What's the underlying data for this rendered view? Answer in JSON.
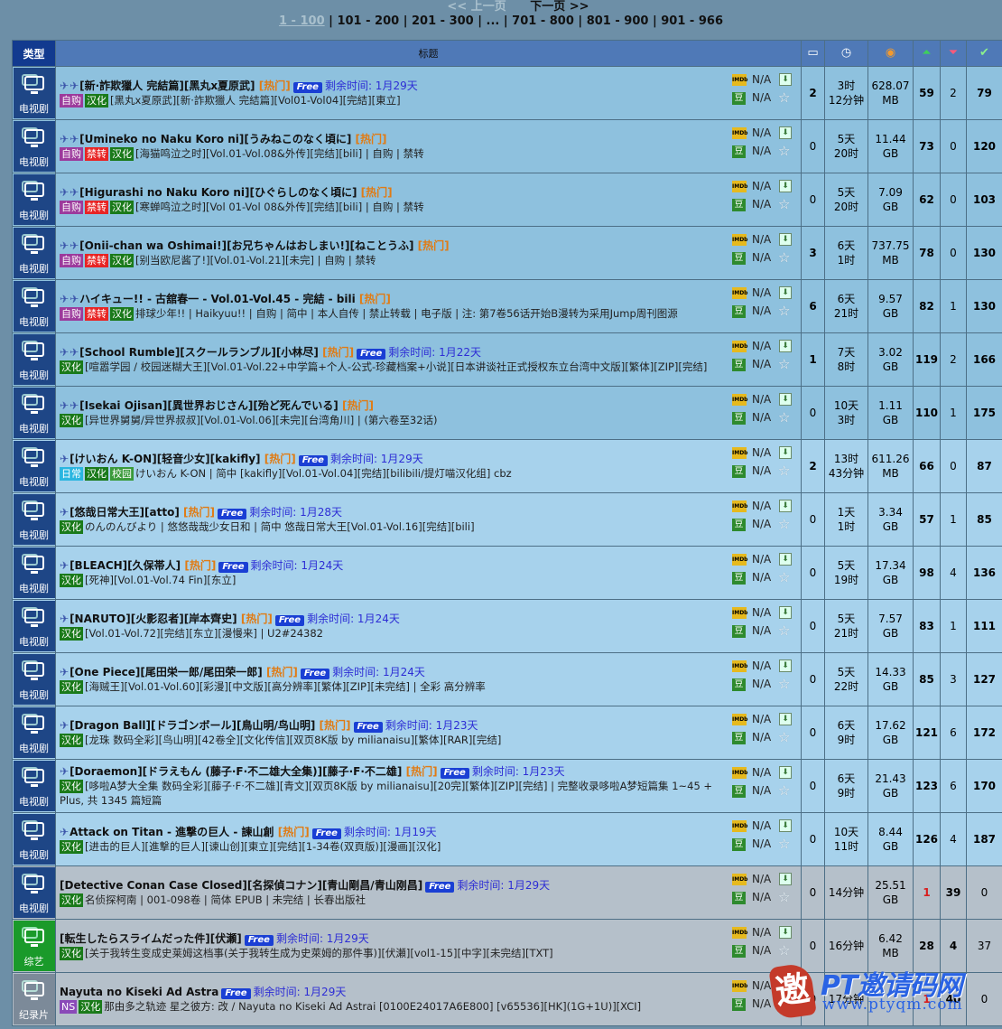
{
  "pager": {
    "prev": "<< 上一页",
    "next": "下一页 >>",
    "current": "1 - 100",
    "pages": [
      "101 - 200",
      "201 - 300",
      "...",
      "701 - 800",
      "801 - 900",
      "901 - 966"
    ]
  },
  "header": {
    "category": "类型",
    "title": "标题",
    "icons": [
      "comments-icon",
      "time-icon",
      "size-icon",
      "seeders-icon",
      "leechers-icon",
      "completed-icon"
    ]
  },
  "rows": [
    {
      "cat": "电视剧",
      "pins": 2,
      "title": "[新·詐欺獵人 完結篇][黑丸x夏原武]",
      "hot": "[热门]",
      "free": true,
      "remain": "剩余时间: 1月29天",
      "tags": [
        "自购",
        "汉化"
      ],
      "sub": "[黑丸x夏原武][新·詐欺獵人 完結篇][Vol01-Vol04][完結][東立]",
      "comments": "2",
      "time1": "3时",
      "time2": "12分钟",
      "size1": "628.07",
      "size2": "MB",
      "se": "59",
      "le": "2",
      "co": "79",
      "style": "c1"
    },
    {
      "cat": "电视剧",
      "pins": 2,
      "title": "[Umineko no Naku Koro ni][うみねこのなく頃に]",
      "hot": "[热门]",
      "free": false,
      "remain": "",
      "tags": [
        "自购",
        "禁转",
        "汉化"
      ],
      "sub": "[海猫鸣泣之时][Vol.01-Vol.08&外传][完结][bili] | 自购 | 禁转",
      "comments": "0",
      "time1": "5天",
      "time2": "20时",
      "size1": "11.44",
      "size2": "GB",
      "se": "73",
      "le": "0",
      "co": "120",
      "style": "c1"
    },
    {
      "cat": "电视剧",
      "pins": 2,
      "title": "[Higurashi no Naku Koro ni][ひぐらしのなく頃に]",
      "hot": "[热门]",
      "free": false,
      "remain": "",
      "tags": [
        "自购",
        "禁转",
        "汉化"
      ],
      "sub": "[寒蝉鸣泣之时][Vol 01-Vol 08&外传][完结][bili] | 自购 | 禁转",
      "comments": "0",
      "time1": "5天",
      "time2": "20时",
      "size1": "7.09",
      "size2": "GB",
      "se": "62",
      "le": "0",
      "co": "103",
      "style": "c1"
    },
    {
      "cat": "电视剧",
      "pins": 2,
      "title": "[Onii-chan wa Oshimai!][お兄ちゃんはおしまい!][ねことうふ]",
      "hot": "[热门]",
      "free": false,
      "remain": "",
      "tags": [
        "自购",
        "禁转",
        "汉化"
      ],
      "sub": "[别当欧尼酱了!][Vol.01-Vol.21][未完] | 自购 | 禁转",
      "comments": "3",
      "time1": "6天",
      "time2": "1时",
      "size1": "737.75",
      "size2": "MB",
      "se": "78",
      "le": "0",
      "co": "130",
      "style": "c1"
    },
    {
      "cat": "电视剧",
      "pins": 2,
      "title": "ハイキュー!! - 古舘春一 - Vol.01-Vol.45 - 完結 - bili",
      "hot": "[热门]",
      "free": false,
      "remain": "",
      "tags": [
        "自购",
        "禁转",
        "汉化"
      ],
      "sub": "排球少年!! | Haikyuu!! | 自购 | 简中 | 本人自传 | 禁止转载 | 电子版 | 注: 第7卷56话开始B漫转为采用Jump周刊图源",
      "comments": "6",
      "time1": "6天",
      "time2": "21时",
      "size1": "9.57",
      "size2": "GB",
      "se": "82",
      "le": "1",
      "co": "130",
      "style": "c1"
    },
    {
      "cat": "电视剧",
      "pins": 2,
      "title": "[School Rumble][スクールランブル][小林尽]",
      "hot": "[热门]",
      "free": true,
      "remain": "剩余时间: 1月22天",
      "tags": [
        "汉化"
      ],
      "sub": "[喧嚣学园 / 校园迷糊大王][Vol.01-Vol.22+中学篇+个人-公式-珍藏档案+小说][日本讲谈社正式授权东立台湾中文版][繁体][ZIP][完结]",
      "comments": "1",
      "time1": "7天",
      "time2": "8时",
      "size1": "3.02",
      "size2": "GB",
      "se": "119",
      "le": "2",
      "co": "166",
      "style": "c1"
    },
    {
      "cat": "电视剧",
      "pins": 2,
      "title": "[Isekai Ojisan][異世界おじさん][殆ど死んでいる]",
      "hot": "[热门]",
      "free": false,
      "remain": "",
      "tags": [
        "汉化"
      ],
      "sub": "[异世界舅舅/异世界叔叔][Vol.01-Vol.06][未完][台湾角川] | (第六卷至32话)",
      "comments": "0",
      "time1": "10天",
      "time2": "3时",
      "size1": "1.11",
      "size2": "GB",
      "se": "110",
      "le": "1",
      "co": "175",
      "style": "c1"
    },
    {
      "cat": "电视剧",
      "pins": 1,
      "title": "[けいおん K-ON][轻音少女][kakifly]",
      "hot": "[热门]",
      "free": true,
      "remain": "剩余时间: 1月29天",
      "tags": [
        "日常",
        "汉化",
        "校园"
      ],
      "sub": "けいおん K-ON | 简中 [kakifly][Vol.01-Vol.04][完结][bilibili/提灯喵汉化组] cbz",
      "comments": "2",
      "time1": "13时",
      "time2": "43分钟",
      "size1": "611.26",
      "size2": "MB",
      "se": "66",
      "le": "0",
      "co": "87",
      "style": "c2"
    },
    {
      "cat": "电视剧",
      "pins": 1,
      "title": "[悠哉日常大王][atto]",
      "hot": "[热门]",
      "free": true,
      "remain": "剩余时间: 1月28天",
      "tags": [
        "汉化"
      ],
      "sub": "のんのんびより | 悠悠哉哉少女日和 | 简中 悠哉日常大王[Vol.01-Vol.16][完结][bili]",
      "comments": "0",
      "time1": "1天",
      "time2": "1时",
      "size1": "3.34",
      "size2": "GB",
      "se": "57",
      "le": "1",
      "co": "85",
      "style": "c2"
    },
    {
      "cat": "电视剧",
      "pins": 1,
      "title": "[BLEACH][久保帯人]",
      "hot": "[热门]",
      "free": true,
      "remain": "剩余时间: 1月24天",
      "tags": [
        "汉化"
      ],
      "sub": "[死神][Vol.01-Vol.74 Fin][东立]",
      "comments": "0",
      "time1": "5天",
      "time2": "19时",
      "size1": "17.34",
      "size2": "GB",
      "se": "98",
      "le": "4",
      "co": "136",
      "style": "c2"
    },
    {
      "cat": "电视剧",
      "pins": 1,
      "title": "[NARUTO][火影忍者][岸本齊史]",
      "hot": "[热门]",
      "free": true,
      "remain": "剩余时间: 1月24天",
      "tags": [
        "汉化"
      ],
      "sub": "[Vol.01-Vol.72][完结][东立][漫慢来] | U2#24382",
      "comments": "0",
      "time1": "5天",
      "time2": "21时",
      "size1": "7.57",
      "size2": "GB",
      "se": "83",
      "le": "1",
      "co": "111",
      "style": "c2"
    },
    {
      "cat": "电视剧",
      "pins": 1,
      "title": "[One Piece][尾田栄一郎/尾田荣一郎]",
      "hot": "[热门]",
      "free": true,
      "remain": "剩余时间: 1月24天",
      "tags": [
        "汉化"
      ],
      "sub": "[海贼王][Vol.01-Vol.60][彩漫][中文版][高分辨率][繁体][ZIP][未完结] | 全彩 高分辨率",
      "comments": "0",
      "time1": "5天",
      "time2": "22时",
      "size1": "14.33",
      "size2": "GB",
      "se": "85",
      "le": "3",
      "co": "127",
      "style": "c2"
    },
    {
      "cat": "电视剧",
      "pins": 1,
      "title": "[Dragon Ball][ドラゴンボール][鳥山明/鸟山明]",
      "hot": "[热门]",
      "free": true,
      "remain": "剩余时间: 1月23天",
      "tags": [
        "汉化"
      ],
      "sub": "[龙珠 数码全彩][鸟山明][42卷全][文化传信][双页8K版 by milianaisu][繁体][RAR][完结]",
      "comments": "0",
      "time1": "6天",
      "time2": "9时",
      "size1": "17.62",
      "size2": "GB",
      "se": "121",
      "le": "6",
      "co": "172",
      "style": "c2"
    },
    {
      "cat": "电视剧",
      "pins": 1,
      "title": "[Doraemon][ドラえもん (藤子·F·不二雄大全集)][藤子·F·不二雄]",
      "hot": "[热门]",
      "free": true,
      "remain": "剩余时间: 1月23天",
      "tags": [
        "汉化"
      ],
      "sub": "[哆啦A梦大全集 数码全彩][藤子·F·不二雄][青文][双页8K版 by milianaisu][20完][繁体][ZIP][完结] | 完整收录哆啦A梦短篇集 1~45 + Plus, 共 1345 篇短篇",
      "comments": "0",
      "time1": "6天",
      "time2": "9时",
      "size1": "21.43",
      "size2": "GB",
      "se": "123",
      "le": "6",
      "co": "170",
      "style": "c2"
    },
    {
      "cat": "电视剧",
      "pins": 1,
      "title": "Attack on Titan - 進撃の巨人 - 諫山創",
      "hot": "[热门]",
      "free": true,
      "remain": "剩余时间: 1月19天",
      "tags": [
        "汉化"
      ],
      "sub": "[进击的巨人][進撃的巨人][谏山创][東立][完结][1-34卷(双頁版)][漫画][汉化]",
      "comments": "0",
      "time1": "10天",
      "time2": "11时",
      "size1": "8.44",
      "size2": "GB",
      "se": "126",
      "le": "4",
      "co": "187",
      "style": "c2"
    },
    {
      "cat": "电视剧",
      "pins": 0,
      "title": "[Detective Conan Case Closed][名探偵コナン][青山剛昌/青山刚昌]",
      "hot": "",
      "free": true,
      "remain": "剩余时间: 1月29天",
      "tags": [
        "汉化"
      ],
      "sub": "名侦探柯南 | 001-098卷 | 简体 EPUB | 未完结 | 长春出版社",
      "comments": "0",
      "time1": "14分钟",
      "time2": "",
      "size1": "25.51",
      "size2": "GB",
      "se": "1",
      "le": "39",
      "co": "0",
      "style": "c3",
      "cat_style": "blue"
    },
    {
      "cat": "综艺",
      "pins": 0,
      "title": "[転生したらスライムだった件][伏瀬]",
      "hot": "",
      "free": true,
      "remain": "剩余时间: 1月29天",
      "tags": [
        "汉化"
      ],
      "sub": "[关于我转生变成史莱姆这档事(关于我转生成为史萊姆的那件事)][伏瀬][vol1-15][中字][未完结][TXT]",
      "comments": "0",
      "time1": "16分钟",
      "time2": "",
      "size1": "6.42",
      "size2": "MB",
      "se": "28",
      "le": "4",
      "co": "37",
      "style": "c3",
      "cat_style": "green"
    },
    {
      "cat": "纪录片",
      "pins": 0,
      "title": "Nayuta no Kiseki Ad Astra",
      "hot": "",
      "free": true,
      "remain": "剩余时间: 1月29天",
      "tags": [
        "NS",
        "汉化"
      ],
      "sub": "那由多之轨迹 星之彼方: 改 / Nayuta no Kiseki Ad Astrai [0100E24017A6E800] [v65536][HK](1G+1U)][XCI]",
      "comments": "0",
      "time1": "17分钟",
      "time2": "",
      "size1": "",
      "size2": "",
      "se": "1",
      "le": "40",
      "co": "0",
      "style": "c3",
      "cat_style": "gray"
    }
  ],
  "misc": {
    "free_label": "Free",
    "imdb_label": "IMDb",
    "douban_label": "豆",
    "na": "N/A",
    "watermark_text": "PT邀请码网",
    "watermark_url": "www.ptyqm.com",
    "watermark_logo": "邀"
  }
}
